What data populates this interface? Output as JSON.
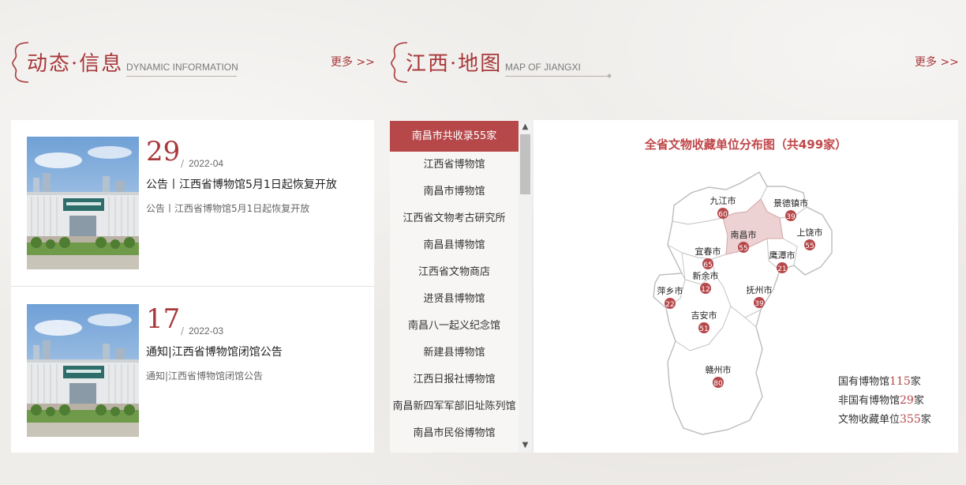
{
  "news_section": {
    "title": "动态·信息",
    "subtitle": "DYNAMIC INFORMATION",
    "more": "更多 >>",
    "items": [
      {
        "day": "29",
        "ym": "2022-04",
        "title": "公告丨江西省博物馆5月1日起恢复开放",
        "summary": "公告丨江西省博物馆5月1日起恢复开放"
      },
      {
        "day": "17",
        "ym": "2022-03",
        "title": "通知|江西省博物馆闭馆公告",
        "summary": "通知|江西省博物馆闭馆公告"
      }
    ]
  },
  "map_section": {
    "title": "江西·地图",
    "subtitle": "MAP OF JIANGXI",
    "more": "更多 >>"
  },
  "museum_list": {
    "header": "南昌市共收录55家",
    "items": [
      "江西省博物馆",
      "南昌市博物馆",
      "江西省文物考古研究所",
      "南昌县博物馆",
      "江西省文物商店",
      "进贤县博物馆",
      "南昌八一起义纪念馆",
      "新建县博物馆",
      "江西日报社博物馆",
      "南昌新四军军部旧址陈列馆",
      "南昌市民俗博物馆"
    ]
  },
  "map": {
    "title": "全省文物收藏单位分布图（共499家）",
    "cities": [
      {
        "name": "九江市",
        "count": "60"
      },
      {
        "name": "景德镇市",
        "count": "39"
      },
      {
        "name": "南昌市",
        "count": "55",
        "selected": true
      },
      {
        "name": "上饶市",
        "count": "55"
      },
      {
        "name": "宜春市",
        "count": "65"
      },
      {
        "name": "鹰潭市",
        "count": "21"
      },
      {
        "name": "新余市",
        "count": "12"
      },
      {
        "name": "萍乡市",
        "count": "22"
      },
      {
        "name": "抚州市",
        "count": "39"
      },
      {
        "name": "吉安市",
        "count": "51"
      },
      {
        "name": "赣州市",
        "count": "80"
      }
    ],
    "legend": [
      {
        "label": "国有博物馆",
        "value": "115",
        "unit": "家"
      },
      {
        "label": "非国有博物馆",
        "value": "29",
        "unit": "家"
      },
      {
        "label": "文物收藏单位",
        "value": "355",
        "unit": "家"
      }
    ],
    "colors": {
      "accent": "#a8383b",
      "marker": "#b6484a",
      "selected_region": "#ecd2d3"
    }
  }
}
